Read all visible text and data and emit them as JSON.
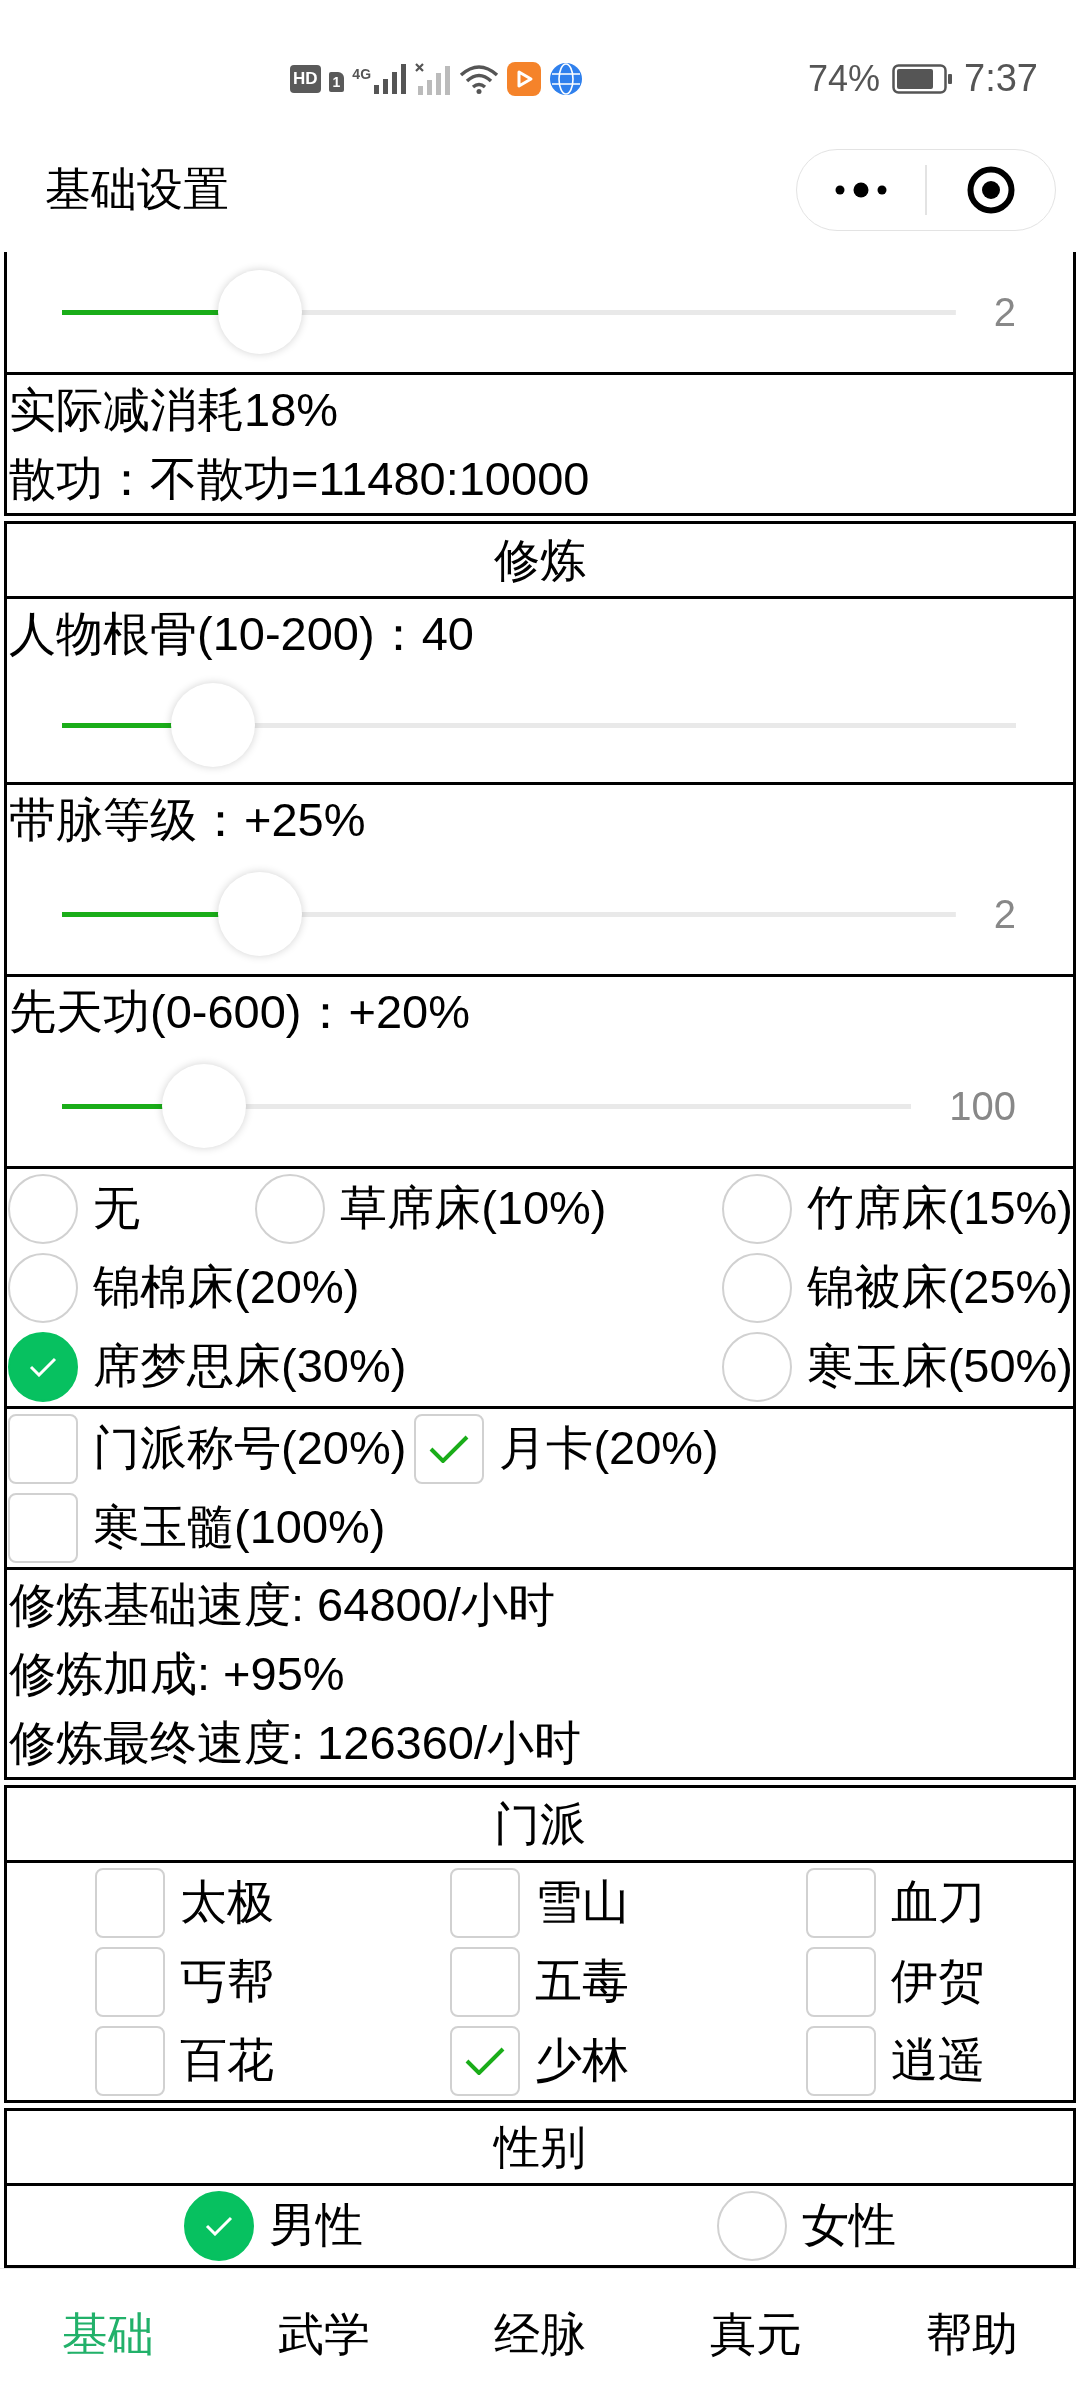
{
  "status_bar": {
    "hd_badge": "HD",
    "sim_slot": "1",
    "network": "4G",
    "battery_percent": "74%",
    "time": "7:37"
  },
  "header": {
    "title": "基础设置"
  },
  "panels": [
    {
      "rows": [
        {
          "kind": "slider",
          "level": 0.222,
          "reading": "2"
        },
        {
          "kind": "text",
          "lines": [
            "实际减消耗18%",
            "散功：不散功=11480:10000"
          ]
        }
      ]
    },
    {
      "title": "修炼",
      "rows": [
        {
          "kind": "slider",
          "label": "人物根骨(10-200)：40",
          "level": 0.158
        },
        {
          "kind": "slider",
          "label": "带脉等级：+25%",
          "level": 0.222,
          "reading": "2"
        },
        {
          "kind": "slider",
          "label": "先天功(0-600)：+20%",
          "level": 0.167,
          "reading": "100"
        },
        {
          "kind": "radio_wrap",
          "options": [
            {
              "label": "无",
              "selected": false
            },
            {
              "label": "草席床(10%)",
              "selected": false
            },
            {
              "label": "竹席床(15%)",
              "selected": false
            },
            {
              "label": "锦棉床(20%)",
              "selected": false
            },
            {
              "label": "锦被床(25%)",
              "selected": false
            },
            {
              "label": "席梦思床(30%)",
              "selected": true
            },
            {
              "label": "寒玉床(50%)",
              "selected": false
            }
          ]
        },
        {
          "kind": "checkbox_wrap",
          "options": [
            {
              "label": "门派称号(20%)",
              "checked": false
            },
            {
              "label": "月卡(20%)",
              "checked": true
            },
            {
              "label": "寒玉髓(100%)",
              "checked": false
            }
          ]
        },
        {
          "kind": "text",
          "lines": [
            "修炼基础速度: 64800/小时",
            "修炼加成: +95%",
            "修炼最终速度: 126360/小时"
          ]
        }
      ]
    },
    {
      "title": "门派",
      "rows": [
        {
          "kind": "checkbox_grid",
          "options": [
            {
              "label": "太极",
              "checked": false
            },
            {
              "label": "雪山",
              "checked": false
            },
            {
              "label": "血刀",
              "checked": false
            },
            {
              "label": "丐帮",
              "checked": false
            },
            {
              "label": "五毒",
              "checked": false
            },
            {
              "label": "伊贺",
              "checked": false
            },
            {
              "label": "百花",
              "checked": false
            },
            {
              "label": "少林",
              "checked": true
            },
            {
              "label": "逍遥",
              "checked": false
            }
          ]
        }
      ]
    },
    {
      "title": "性别",
      "rows": [
        {
          "kind": "radio_grid",
          "options": [
            {
              "label": "男性",
              "selected": true
            },
            {
              "label": "女性",
              "selected": false
            }
          ]
        }
      ]
    }
  ],
  "tabs": [
    {
      "label": "基础",
      "selected": true
    },
    {
      "label": "武学",
      "selected": false
    },
    {
      "label": "经脉",
      "selected": false
    },
    {
      "label": "真元",
      "selected": false
    },
    {
      "label": "帮助",
      "selected": false
    }
  ]
}
